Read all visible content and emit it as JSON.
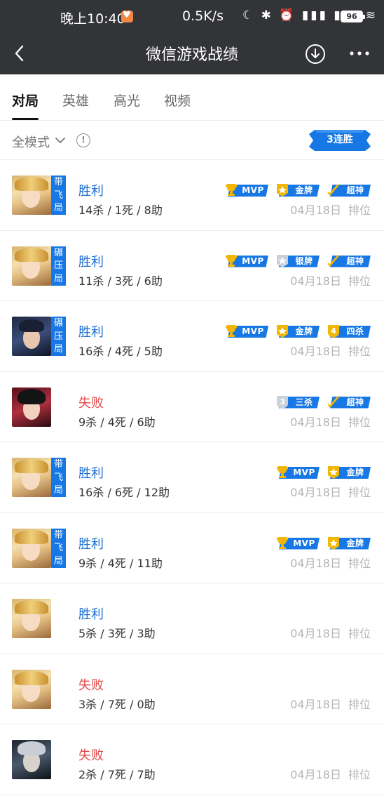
{
  "status_bar": {
    "time": "晚上10:40",
    "network_speed": "0.5K/s",
    "icons_text": "☾ ✱ ⏰ ▮▮▮ ▮▮▮ ≋",
    "battery": "96"
  },
  "nav": {
    "title": "微信游戏战绩"
  },
  "tabs": [
    {
      "label": "对局"
    },
    {
      "label": "英雄"
    },
    {
      "label": "高光"
    },
    {
      "label": "视频"
    }
  ],
  "filter": {
    "mode": "全模式",
    "info": "!",
    "streak": "3连胜"
  },
  "colors": {
    "header_bg": "#333438",
    "accent_blue": "#1677e5",
    "win_blue": "#1a6fd1",
    "lose_red": "#e34a4a",
    "badge_gold": "#f2b705"
  },
  "matches": [
    {
      "avatar": "blonde-hero",
      "tag": [
        "带",
        "飞",
        "局"
      ],
      "result": "胜利",
      "outcome": "win",
      "kda": "14杀 / 1死 / 8助",
      "date": "04月18日",
      "mode": "排位",
      "badges": [
        {
          "icon": "trophy-icon",
          "text": "MVP"
        },
        {
          "icon": "medal-gold-icon",
          "text": "金牌"
        },
        {
          "icon": "sword-icon",
          "text": "超神"
        }
      ]
    },
    {
      "avatar": "blonde-hero",
      "tag": [
        "碾",
        "压",
        "局"
      ],
      "result": "胜利",
      "outcome": "win",
      "kda": "11杀 / 3死 / 6助",
      "date": "04月18日",
      "mode": "排位",
      "badges": [
        {
          "icon": "trophy-icon",
          "text": "MVP"
        },
        {
          "icon": "medal-silver-icon",
          "text": "银牌"
        },
        {
          "icon": "sword-icon",
          "text": "超神"
        }
      ]
    },
    {
      "avatar": "dark-hair-hero",
      "tag": [
        "碾",
        "压",
        "局"
      ],
      "result": "胜利",
      "outcome": "win",
      "kda": "16杀 / 4死 / 5助",
      "date": "04月18日",
      "mode": "排位",
      "badges": [
        {
          "icon": "trophy-icon",
          "text": "MVP"
        },
        {
          "icon": "medal-gold-icon",
          "text": "金牌"
        },
        {
          "icon": "four-kill-icon",
          "text": "四杀"
        }
      ]
    },
    {
      "avatar": "red-hero",
      "tag": null,
      "result": "失败",
      "outcome": "lose",
      "kda": "9杀 / 4死 / 6助",
      "date": "04月18日",
      "mode": "排位",
      "badges": [
        {
          "icon": "triple-kill-shield-icon",
          "text": "三杀"
        },
        {
          "icon": "sword-icon",
          "text": "超神"
        }
      ]
    },
    {
      "avatar": "blonde-hero",
      "tag": [
        "带",
        "飞",
        "局"
      ],
      "result": "胜利",
      "outcome": "win",
      "kda": "16杀 / 6死 / 12助",
      "date": "04月18日",
      "mode": "排位",
      "badges": [
        {
          "icon": "trophy-icon",
          "text": "MVP"
        },
        {
          "icon": "medal-gold-icon",
          "text": "金牌"
        }
      ]
    },
    {
      "avatar": "blonde-hero",
      "tag": [
        "带",
        "飞",
        "局"
      ],
      "result": "胜利",
      "outcome": "win",
      "kda": "9杀 / 4死 / 11助",
      "date": "04月18日",
      "mode": "排位",
      "badges": [
        {
          "icon": "trophy-icon",
          "text": "MVP"
        },
        {
          "icon": "medal-gold-icon",
          "text": "金牌"
        }
      ]
    },
    {
      "avatar": "blonde-hero",
      "tag": null,
      "result": "胜利",
      "outcome": "win",
      "kda": "5杀 / 3死 / 3助",
      "date": "04月18日",
      "mode": "排位",
      "badges": []
    },
    {
      "avatar": "blonde-hero",
      "tag": null,
      "result": "失败",
      "outcome": "lose",
      "kda": "3杀 / 7死 / 0助",
      "date": "04月18日",
      "mode": "排位",
      "badges": []
    },
    {
      "avatar": "silver-hair-hero",
      "tag": null,
      "result": "失败",
      "outcome": "lose",
      "kda": "2杀 / 7死 / 7助",
      "date": "04月18日",
      "mode": "排位",
      "badges": []
    }
  ]
}
